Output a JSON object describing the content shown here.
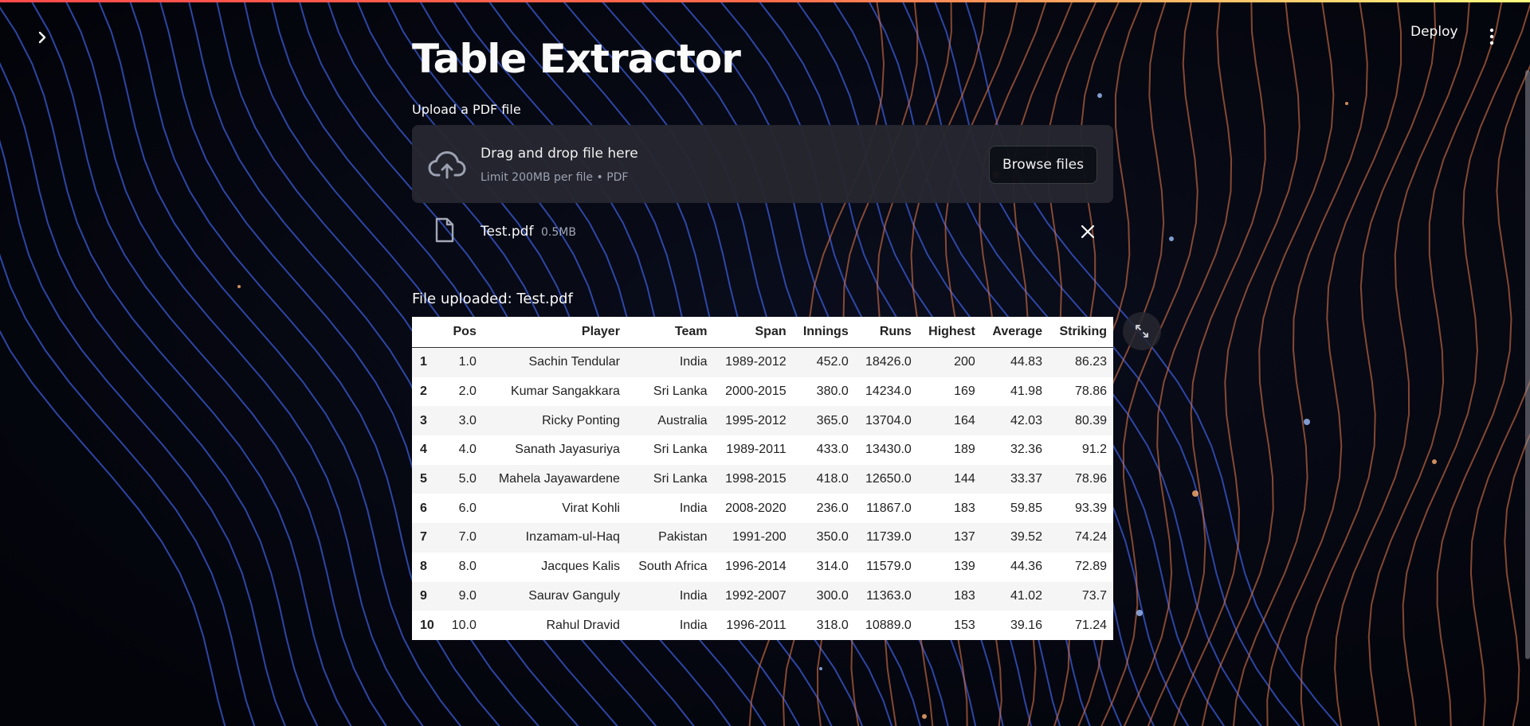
{
  "header": {
    "deploy_label": "Deploy",
    "sidebar_toggle_icon": "chevron-right-icon",
    "menu_icon": "more-vertical-icon"
  },
  "main": {
    "title": "Table Extractor",
    "uploader": {
      "label": "Upload a PDF file",
      "drop_title": "Drag and drop file here",
      "drop_subtitle": "Limit 200MB per file • PDF",
      "browse_label": "Browse files",
      "icon": "cloud-upload-icon"
    },
    "file": {
      "name": "Test.pdf",
      "size": "0.5MB",
      "icon": "file-icon"
    },
    "status": "File uploaded: Test.pdf",
    "table": {
      "columns": [
        "",
        "Pos",
        "Player",
        "Team",
        "Span",
        "Innings",
        "Runs",
        "Highest",
        "Average",
        "Striking"
      ],
      "rows": [
        [
          "1",
          "1.0",
          "Sachin Tendular",
          "India",
          "1989-2012",
          "452.0",
          "18426.0",
          "200",
          "44.83",
          "86.23"
        ],
        [
          "2",
          "2.0",
          "Kumar Sangakkara",
          "Sri Lanka",
          "2000-2015",
          "380.0",
          "14234.0",
          "169",
          "41.98",
          "78.86"
        ],
        [
          "3",
          "3.0",
          "Ricky Ponting",
          "Australia",
          "1995-2012",
          "365.0",
          "13704.0",
          "164",
          "42.03",
          "80.39"
        ],
        [
          "4",
          "4.0",
          "Sanath Jayasuriya",
          "Sri Lanka",
          "1989-2011",
          "433.0",
          "13430.0",
          "189",
          "32.36",
          "91.2"
        ],
        [
          "5",
          "5.0",
          "Mahela Jayawardene",
          "Sri Lanka",
          "1998-2015",
          "418.0",
          "12650.0",
          "144",
          "33.37",
          "78.96"
        ],
        [
          "6",
          "6.0",
          "Virat Kohli",
          "India",
          "2008-2020",
          "236.0",
          "11867.0",
          "183",
          "59.85",
          "93.39"
        ],
        [
          "7",
          "7.0",
          "Inzamam-ul-Haq",
          "Pakistan",
          "1991-200",
          "350.0",
          "11739.0",
          "137",
          "39.52",
          "74.24"
        ],
        [
          "8",
          "8.0",
          "Jacques Kalis",
          "South Africa",
          "1996-2014",
          "314.0",
          "11579.0",
          "139",
          "44.36",
          "72.89"
        ],
        [
          "9",
          "9.0",
          "Saurav Ganguly",
          "India",
          "1992-2007",
          "300.0",
          "11363.0",
          "183",
          "41.02",
          "73.7"
        ],
        [
          "10",
          "10.0",
          "Rahul Dravid",
          "India",
          "1996-2011",
          "318.0",
          "10889.0",
          "153",
          "39.16",
          "71.24"
        ]
      ]
    },
    "expand_icon": "fullscreen-expand-icon"
  },
  "colors": {
    "accent_gradient_start": "#ff4b4b",
    "accent_gradient_end": "#fffd80",
    "dropzone_bg": "#262730"
  }
}
